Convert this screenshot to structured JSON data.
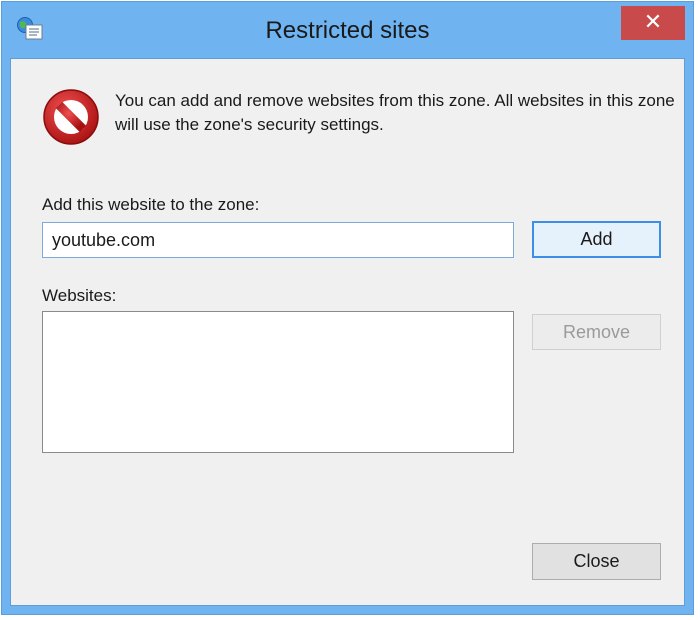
{
  "window": {
    "title": "Restricted sites",
    "close_glyph": "✕",
    "app_icon": "internet-options-icon"
  },
  "info": {
    "icon": "restricted-no-entry-icon",
    "text": "You can add and remove websites from this zone. All websites in this zone will use the zone's security settings."
  },
  "add_section": {
    "label": "Add this website to the zone:",
    "input_value": "youtube.com",
    "add_button": "Add"
  },
  "websites_section": {
    "label": "Websites:",
    "items": [],
    "remove_button": "Remove"
  },
  "footer": {
    "close_button": "Close"
  },
  "colors": {
    "titlebar": "#6fb3f0",
    "close_button": "#c94a4a",
    "client_background": "#f0f0f0",
    "focus_border": "#3c8ee6"
  }
}
